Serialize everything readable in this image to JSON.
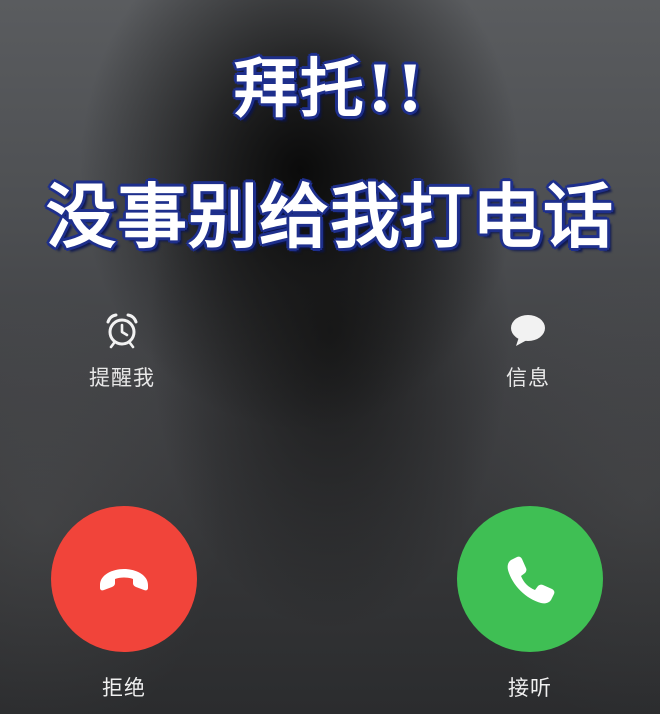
{
  "caption": {
    "line1": "拜托!!",
    "line2": "没事别给我打电话"
  },
  "actions": {
    "remind": {
      "label": "提醒我",
      "icon": "alarm-clock-icon"
    },
    "message": {
      "label": "信息",
      "icon": "chat-bubble-icon"
    }
  },
  "call": {
    "decline": {
      "label": "拒绝",
      "icon": "hang-up-phone-icon",
      "color": "#f1443a"
    },
    "accept": {
      "label": "接听",
      "icon": "phone-icon",
      "color": "#3fbf54"
    }
  }
}
